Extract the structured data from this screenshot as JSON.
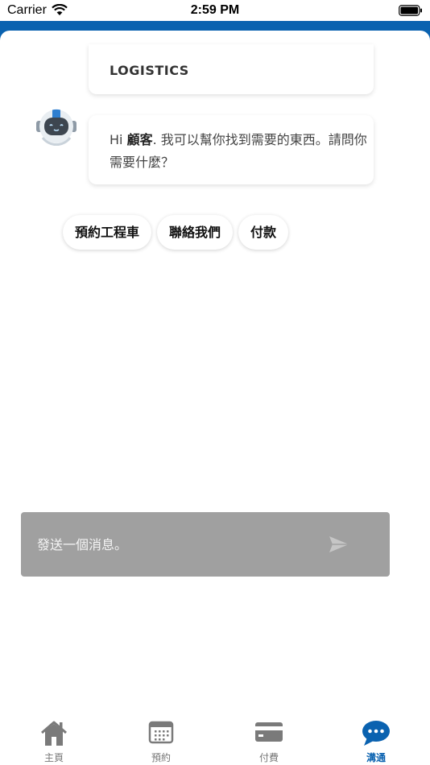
{
  "status_bar": {
    "carrier": "Carrier",
    "time": "2:59 PM"
  },
  "chat": {
    "bubble_title": "LOGISTICS",
    "greeting_prefix": "Hi ",
    "greeting_name": "顧客",
    "greeting_rest": ". 我可以幫你找到需要的東西。請問你需要什麼？",
    "quick_replies": [
      "預約工程車",
      "聯絡我們",
      "付款"
    ]
  },
  "composer": {
    "placeholder": "發送一個消息。"
  },
  "tabs": [
    {
      "label": "主頁",
      "icon": "home-icon"
    },
    {
      "label": "預約",
      "icon": "calendar-icon"
    },
    {
      "label": "付費",
      "icon": "credit-card-icon"
    },
    {
      "label": "溝通",
      "icon": "chat-bubble-icon"
    }
  ],
  "colors": {
    "brand": "#0a62b0",
    "composer": "#a0a0a0",
    "tab_inactive": "#777777"
  }
}
